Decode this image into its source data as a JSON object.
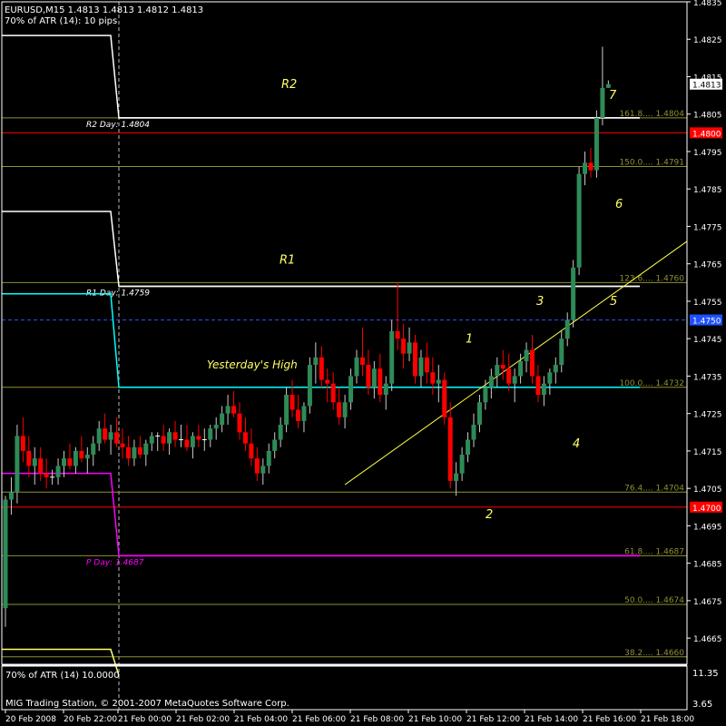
{
  "header": {
    "line1": "EURUSD,M15  1.4813 1.4813 1.4812 1.4813",
    "line2": "70% of ATR (14): 10 pips"
  },
  "sub_panel": {
    "label": "70% of ATR (14) 10.0000",
    "axis_ticks": [
      "11.35",
      "3.65"
    ]
  },
  "copyright": "MIG Trading Station, © 2001-2007 MetaQuotes Software Corp.",
  "colors": {
    "background": "#000000",
    "frame": "#ffffff",
    "bull_candle": "#2e8b57",
    "bear_candle": "#ff0000",
    "doji": "#ffffff",
    "fib": "#8f8f30",
    "annotation": "#ffff66",
    "trendline": "#ffff44",
    "pivot": "#ffffff",
    "r1_line": "#ffffff",
    "yesterday_high": "#00ffff",
    "p_day": "#ff00ff",
    "red_line": "#ff0000",
    "dashed_level": "#4060ff"
  },
  "chart_data": {
    "type": "candlestick",
    "symbol": "EURUSD",
    "timeframe": "M15",
    "ylim": [
      1.4658,
      1.4835
    ],
    "y_ticks": [
      "1.4835",
      "1.4825",
      "1.4815",
      "1.4805",
      "1.4795",
      "1.4785",
      "1.4775",
      "1.4765",
      "1.4755",
      "1.4745",
      "1.4735",
      "1.4725",
      "1.4715",
      "1.4705",
      "1.4695",
      "1.4685",
      "1.4675",
      "1.4665"
    ],
    "x_ticks": [
      "20 Feb 2008",
      "20 Feb 22:00",
      "21 Feb 00:00",
      "21 Feb 02:00",
      "21 Feb 04:00",
      "21 Feb 06:00",
      "21 Feb 08:00",
      "21 Feb 10:00",
      "21 Feb 12:00",
      "21 Feb 14:00",
      "21 Feb 16:00",
      "21 Feb 18:00"
    ],
    "price_badges": [
      {
        "text": "1.4813",
        "value": 1.4813,
        "bg": "#ffffff",
        "fg": "#000000"
      },
      {
        "text": "1.4800",
        "value": 1.48,
        "bg": "#ff0000",
        "fg": "#ffffff"
      },
      {
        "text": "1.4750",
        "value": 1.475,
        "bg": "#1e50ff",
        "fg": "#ffffff"
      },
      {
        "text": "1.4700",
        "value": 1.47,
        "bg": "#ff0000",
        "fg": "#ffffff"
      }
    ],
    "levels": [
      {
        "name": "R2 Day",
        "value": 1.4804,
        "label": "R2 Day: 1.4804",
        "color": "#ffffff"
      },
      {
        "name": "R1 Day",
        "value": 1.4759,
        "label": "R1 Day: 1.4759",
        "color": "#ffffff"
      },
      {
        "name": "P Day",
        "value": 1.4687,
        "label": "P Day: 1.4687",
        "color": "#ff00ff"
      },
      {
        "name": "Yesterday's High",
        "value": 1.4732,
        "label": "",
        "color": "#00ffff"
      },
      {
        "name": "red 1.4800",
        "value": 1.48,
        "label": "",
        "color": "#ff0000"
      },
      {
        "name": "red 1.4700",
        "value": 1.47,
        "label": "",
        "color": "#ff0000"
      },
      {
        "name": "blue 1.4750",
        "value": 1.475,
        "label": "",
        "color": "#3050ff"
      }
    ],
    "fib_levels": [
      {
        "label": "161.8....  1.4804",
        "value": 1.4804
      },
      {
        "label": "150.0....  1.4791",
        "value": 1.4791
      },
      {
        "label": "123.6....  1.4760",
        "value": 1.476
      },
      {
        "label": "100.0....  1.4732",
        "value": 1.4732
      },
      {
        "label": "76.4....  1.4704",
        "value": 1.4704
      },
      {
        "label": "61.8....  1.4687",
        "value": 1.4687
      },
      {
        "label": "50.0....  1.4674",
        "value": 1.4674
      },
      {
        "label": "38.2....  1.4660",
        "value": 1.466
      }
    ],
    "annotations": [
      "R2",
      "R1",
      "Yesterday's High",
      "1",
      "2",
      "3",
      "4",
      "5",
      "6",
      "7"
    ],
    "trendline": {
      "from": {
        "bar": 58,
        "price": 1.4706
      },
      "to": {
        "bar": 124,
        "price": 1.4771
      }
    },
    "candles": [
      [
        1.4673,
        1.4703,
        1.4668,
        1.4702
      ],
      [
        1.4702,
        1.4708,
        1.4698,
        1.4704
      ],
      [
        1.4704,
        1.4722,
        1.4701,
        1.4719
      ],
      [
        1.4719,
        1.4724,
        1.4712,
        1.4715
      ],
      [
        1.4715,
        1.4719,
        1.4708,
        1.4711
      ],
      [
        1.4711,
        1.4716,
        1.4706,
        1.4713
      ],
      [
        1.4713,
        1.4716,
        1.4707,
        1.4709
      ],
      [
        1.4709,
        1.4713,
        1.4705,
        1.4708
      ],
      [
        1.4708,
        1.471,
        1.4706,
        1.4708
      ],
      [
        1.4708,
        1.4713,
        1.4706,
        1.4711
      ],
      [
        1.4711,
        1.4715,
        1.4708,
        1.4713
      ],
      [
        1.4713,
        1.4717,
        1.471,
        1.4711
      ],
      [
        1.4711,
        1.4716,
        1.4709,
        1.4715
      ],
      [
        1.4715,
        1.4719,
        1.4712,
        1.4713
      ],
      [
        1.4713,
        1.4716,
        1.4709,
        1.4714
      ],
      [
        1.4714,
        1.4719,
        1.4711,
        1.4717
      ],
      [
        1.4717,
        1.4723,
        1.4715,
        1.4721
      ],
      [
        1.4721,
        1.4725,
        1.4717,
        1.4718
      ],
      [
        1.4718,
        1.4722,
        1.4714,
        1.472
      ],
      [
        1.472,
        1.4724,
        1.4716,
        1.4717
      ],
      [
        1.4717,
        1.4721,
        1.4713,
        1.4716
      ],
      [
        1.4716,
        1.4719,
        1.4711,
        1.4713
      ],
      [
        1.4713,
        1.4718,
        1.4711,
        1.4716
      ],
      [
        1.4716,
        1.4719,
        1.4713,
        1.4714
      ],
      [
        1.4714,
        1.4718,
        1.4711,
        1.4717
      ],
      [
        1.4717,
        1.472,
        1.4715,
        1.4719
      ],
      [
        1.4719,
        1.472,
        1.4715,
        1.4719
      ],
      [
        1.4719,
        1.4722,
        1.4715,
        1.4717
      ],
      [
        1.4717,
        1.4721,
        1.4714,
        1.472
      ],
      [
        1.472,
        1.4723,
        1.4716,
        1.4718
      ],
      [
        1.4718,
        1.4722,
        1.4716,
        1.4718
      ],
      [
        1.4718,
        1.4722,
        1.4715,
        1.4716
      ],
      [
        1.4716,
        1.472,
        1.4713,
        1.4719
      ],
      [
        1.4719,
        1.4722,
        1.4716,
        1.4718
      ],
      [
        1.4718,
        1.4721,
        1.4715,
        1.4718
      ],
      [
        1.4718,
        1.4722,
        1.4716,
        1.4721
      ],
      [
        1.4721,
        1.4724,
        1.4718,
        1.4722
      ],
      [
        1.4722,
        1.4727,
        1.472,
        1.4725
      ],
      [
        1.4725,
        1.473,
        1.4722,
        1.4727
      ],
      [
        1.4727,
        1.4731,
        1.4724,
        1.4725
      ],
      [
        1.4725,
        1.4728,
        1.4718,
        1.472
      ],
      [
        1.472,
        1.4724,
        1.4715,
        1.4717
      ],
      [
        1.4717,
        1.4721,
        1.4711,
        1.4713
      ],
      [
        1.4713,
        1.4716,
        1.4707,
        1.4709
      ],
      [
        1.4709,
        1.4713,
        1.4706,
        1.4711
      ],
      [
        1.4711,
        1.4717,
        1.4709,
        1.4715
      ],
      [
        1.4715,
        1.472,
        1.4713,
        1.4718
      ],
      [
        1.4718,
        1.4724,
        1.4716,
        1.4722
      ],
      [
        1.4722,
        1.4732,
        1.472,
        1.473
      ],
      [
        1.473,
        1.4734,
        1.4724,
        1.4726
      ],
      [
        1.4726,
        1.473,
        1.4721,
        1.4723
      ],
      [
        1.4723,
        1.4728,
        1.472,
        1.4727
      ],
      [
        1.4727,
        1.474,
        1.4725,
        1.4738
      ],
      [
        1.4738,
        1.4744,
        1.4733,
        1.474
      ],
      [
        1.474,
        1.4743,
        1.4732,
        1.4734
      ],
      [
        1.4734,
        1.4737,
        1.4728,
        1.4733
      ],
      [
        1.4733,
        1.4736,
        1.4726,
        1.4728
      ],
      [
        1.4728,
        1.4732,
        1.4722,
        1.4724
      ],
      [
        1.4724,
        1.473,
        1.4721,
        1.4728
      ],
      [
        1.4728,
        1.4737,
        1.4726,
        1.4735
      ],
      [
        1.4735,
        1.4742,
        1.4733,
        1.474
      ],
      [
        1.474,
        1.4748,
        1.4735,
        1.4738
      ],
      [
        1.4738,
        1.4742,
        1.473,
        1.4732
      ],
      [
        1.4732,
        1.4739,
        1.4729,
        1.4737
      ],
      [
        1.4737,
        1.4741,
        1.4728,
        1.473
      ],
      [
        1.473,
        1.4735,
        1.4726,
        1.4733
      ],
      [
        1.4733,
        1.475,
        1.4731,
        1.4747
      ],
      [
        1.4747,
        1.476,
        1.4742,
        1.4745
      ],
      [
        1.4745,
        1.4749,
        1.4737,
        1.4741
      ],
      [
        1.4741,
        1.4748,
        1.4739,
        1.4744
      ],
      [
        1.4744,
        1.4746,
        1.4733,
        1.4735
      ],
      [
        1.4735,
        1.4742,
        1.4732,
        1.474
      ],
      [
        1.474,
        1.4744,
        1.4733,
        1.4736
      ],
      [
        1.4736,
        1.474,
        1.473,
        1.4733
      ],
      [
        1.4733,
        1.4738,
        1.4728,
        1.4734
      ],
      [
        1.4734,
        1.4736,
        1.4722,
        1.4724
      ],
      [
        1.4724,
        1.4728,
        1.4705,
        1.4707
      ],
      [
        1.4707,
        1.4712,
        1.4703,
        1.4709
      ],
      [
        1.4709,
        1.4716,
        1.4707,
        1.4714
      ],
      [
        1.4714,
        1.472,
        1.4712,
        1.4718
      ],
      [
        1.4718,
        1.4725,
        1.4716,
        1.4722
      ],
      [
        1.4722,
        1.473,
        1.472,
        1.4728
      ],
      [
        1.4728,
        1.4734,
        1.4726,
        1.4732
      ],
      [
        1.4732,
        1.4737,
        1.4729,
        1.4735
      ],
      [
        1.4735,
        1.474,
        1.4732,
        1.4738
      ],
      [
        1.4738,
        1.4742,
        1.4734,
        1.4737
      ],
      [
        1.4737,
        1.4741,
        1.4731,
        1.4733
      ],
      [
        1.4733,
        1.4737,
        1.4728,
        1.4735
      ],
      [
        1.4735,
        1.4741,
        1.4733,
        1.4739
      ],
      [
        1.4739,
        1.4744,
        1.4736,
        1.4742
      ],
      [
        1.4742,
        1.4746,
        1.4733,
        1.4735
      ],
      [
        1.4735,
        1.4738,
        1.4728,
        1.473
      ],
      [
        1.473,
        1.4735,
        1.4727,
        1.4733
      ],
      [
        1.4733,
        1.4737,
        1.473,
        1.4736
      ],
      [
        1.4736,
        1.474,
        1.4733,
        1.4738
      ],
      [
        1.4738,
        1.4747,
        1.4736,
        1.4745
      ],
      [
        1.4745,
        1.4752,
        1.4743,
        1.475
      ],
      [
        1.475,
        1.4766,
        1.4748,
        1.4764
      ],
      [
        1.4764,
        1.4791,
        1.4762,
        1.4789
      ],
      [
        1.4789,
        1.4795,
        1.4786,
        1.4792
      ],
      [
        1.4792,
        1.4796,
        1.4788,
        1.479
      ],
      [
        1.479,
        1.4806,
        1.4788,
        1.4804
      ],
      [
        1.4804,
        1.4823,
        1.4802,
        1.4812
      ],
      [
        1.4812,
        1.4814,
        1.4812,
        1.4813
      ]
    ]
  }
}
